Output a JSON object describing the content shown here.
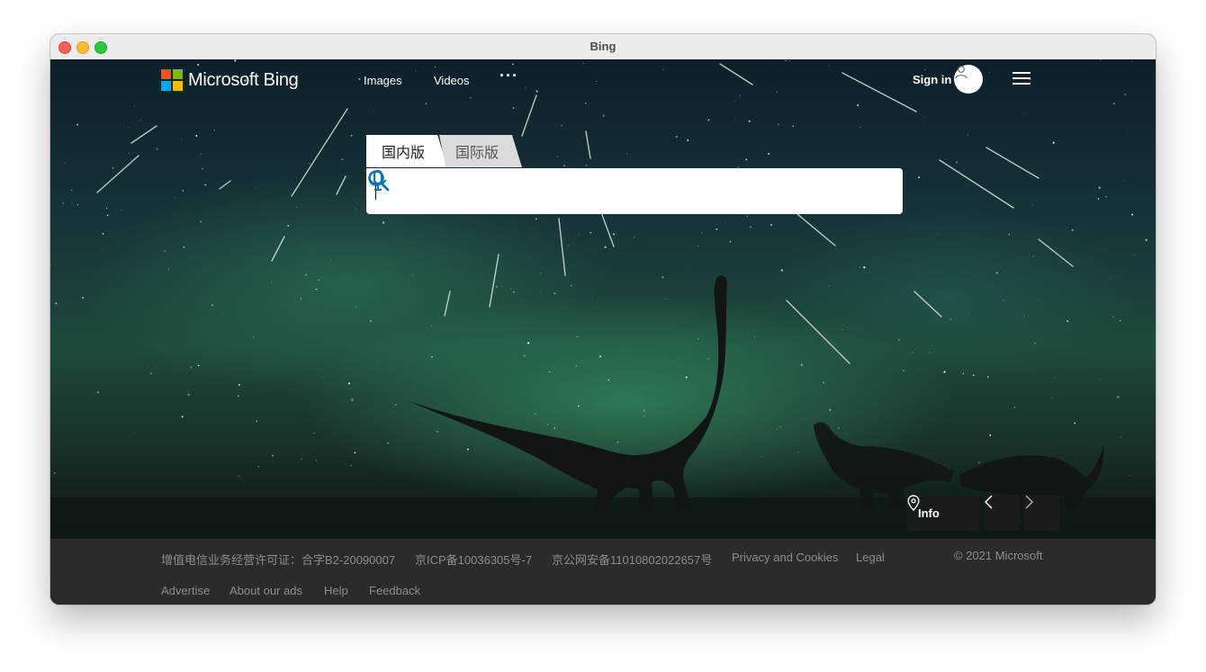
{
  "window": {
    "title": "Bing"
  },
  "header": {
    "logo_text": "Microsoft Bing",
    "nav": [
      {
        "label": "Images"
      },
      {
        "label": "Videos"
      }
    ],
    "more_label": "···",
    "signin_label": "Sign in"
  },
  "search": {
    "tabs": [
      {
        "label": "国内版",
        "active": true
      },
      {
        "label": "国际版",
        "active": false
      }
    ],
    "query": ""
  },
  "hero": {
    "info_label": "Info"
  },
  "footer": {
    "row1": [
      {
        "label": "增值电信业务经营许可证：合字B2-20090007"
      },
      {
        "label": "京ICP备10036305号-7"
      },
      {
        "label": "京公网安备11010802022657号"
      },
      {
        "label": "Privacy and Cookies"
      },
      {
        "label": "Legal"
      }
    ],
    "copyright": "© 2021 Microsoft",
    "row2": [
      {
        "label": "Advertise"
      },
      {
        "label": "About our ads"
      },
      {
        "label": "Help"
      },
      {
        "label": "Feedback"
      }
    ]
  },
  "colors": {
    "ms_red": "#f25022",
    "ms_green": "#7fba00",
    "ms_blue": "#00a4ef",
    "ms_yellow": "#ffb900",
    "search_icon_blue": "#0c74b4"
  }
}
